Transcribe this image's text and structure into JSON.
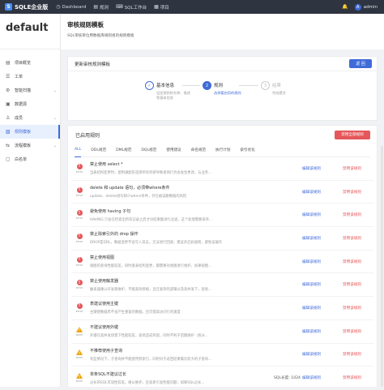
{
  "topbar": {
    "brand": "SQLE企业版",
    "nav": [
      {
        "icon": "dashboard-icon",
        "glyph": "◷",
        "label": "Dashboard"
      },
      {
        "icon": "rules-icon",
        "glyph": "▤",
        "label": "规则"
      },
      {
        "icon": "workbench-icon",
        "glyph": "⌨",
        "label": "SQL工作台"
      },
      {
        "icon": "project-icon",
        "glyph": "▦",
        "label": "项目"
      }
    ],
    "user": "admin"
  },
  "sidebar": {
    "project": "default",
    "items": [
      {
        "icon": "overview-icon",
        "glyph": "▤",
        "label": "项目概览"
      },
      {
        "icon": "workorder-icon",
        "glyph": "☰",
        "label": "工单"
      },
      {
        "icon": "scan-icon",
        "glyph": "⚙",
        "label": "智能扫描"
      },
      {
        "icon": "database-icon",
        "glyph": "▣",
        "label": "数据源"
      },
      {
        "icon": "member-icon",
        "glyph": "♙",
        "label": "成员"
      },
      {
        "icon": "rule-template-icon",
        "glyph": "▧",
        "label": "规则模板"
      },
      {
        "icon": "process-icon",
        "glyph": "⇆",
        "label": "流程模板"
      },
      {
        "icon": "whitelist-icon",
        "glyph": "▢",
        "label": "白名单"
      }
    ]
  },
  "page": {
    "title": "审核规则模板",
    "subtitle": "SQL审核单位用数据库规则组的规则模板"
  },
  "form_card": {
    "title": "更新审核规则模板",
    "back_label": "返 回",
    "steps": [
      {
        "num": "✓",
        "title": "基本信息",
        "desc1": "设定规则的名称、描述",
        "desc2": "等基本信息"
      },
      {
        "num": "2",
        "title": "规则",
        "desc1": "选择要启用的规则",
        "desc2": ""
      },
      {
        "num": "3",
        "title": "结果",
        "desc1": "完成提交",
        "desc2": ""
      }
    ]
  },
  "rules_card": {
    "title": "已启用规则",
    "remove_all_label": "禁用全部规则",
    "tabs": [
      "ALL",
      "DDL规范",
      "DML规范",
      "DQL规范",
      "使用建议",
      "命名规范",
      "执行计划",
      "索引优化"
    ],
    "edit_label": "编辑该规则",
    "disable_label": "禁用该规则",
    "rows": [
      {
        "level": "error",
        "name": "禁止使用 select *",
        "desc": "当表结构变更时，使用通配符选择所有列将导致查询行为会发生更改，与业务...",
        "extra": ""
      },
      {
        "level": "error",
        "name": "delete 和 update 语句，必须带where条件",
        "desc": "update、delete语句缺少where条件，存在被误删数据的风险",
        "extra": ""
      },
      {
        "level": "error",
        "name": "避免使用 having 子句",
        "desc": "HAVING 只会在检索出所有记录之后才对结果集进行过滤，这个处理需要排序...",
        "extra": ""
      },
      {
        "level": "error",
        "name": "禁止除索引外的 drop 操作",
        "desc": "DROP是DDL，数据变更不会写入日志，无法进行回滚；建议开启此规则，避免误操作",
        "extra": ""
      },
      {
        "level": "error",
        "name": "禁止使用视图",
        "desc": "视图的查询性能较差，同时基表结构变更，都需要对视图进行维护，如果视图...",
        "extra": ""
      },
      {
        "level": "error",
        "name": "禁止使用触发器",
        "desc": "触发器难以开发和维护，不能高效移植，且在复杂的逻辑以及高并发下，容易...",
        "extra": ""
      },
      {
        "level": "error",
        "name": "表建议使用主键",
        "desc": "主键使数据库不会产生重复的数据，且可提高访问行的速度",
        "extra": ""
      },
      {
        "level": "warn",
        "name": "不建议使用外键",
        "desc": "外键在高并发场景下性能较差，容易造成死锁，同时不利于后期维护（拆分...",
        "extra": ""
      },
      {
        "level": "warn",
        "name": "不推荐使用子查询",
        "desc": "有些情况下，子查询并不能使用到索引，同时对于返回结果集比较大的子查询...",
        "extra": ""
      },
      {
        "level": "warn",
        "name": "单条SQL不建议过长",
        "desc": "过长的SQL可读性较差，难以维护，且容易引发性能问题；如果SQL过长...",
        "extra": "SQL长度: 1024"
      }
    ]
  }
}
